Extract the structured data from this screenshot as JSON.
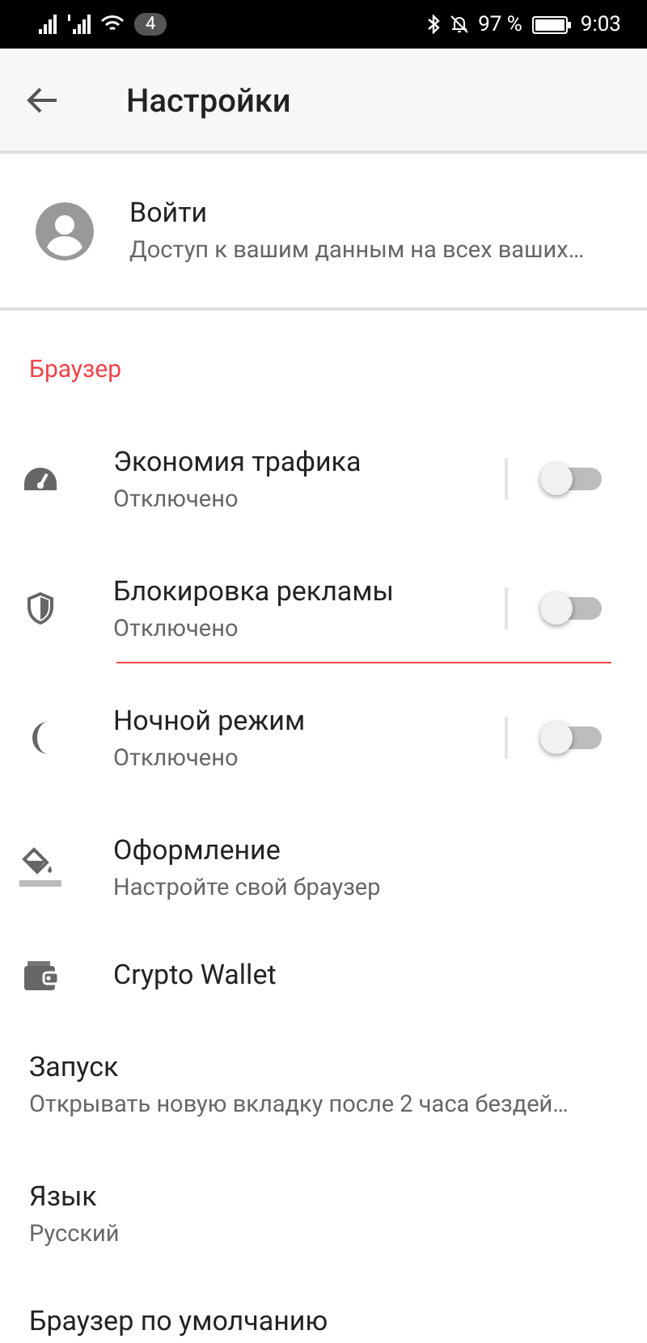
{
  "status_bar": {
    "notification_count": "4",
    "battery": "97 %",
    "time": "9:03"
  },
  "app_bar": {
    "title": "Настройки"
  },
  "account": {
    "title": "Войти",
    "subtitle": "Доступ к вашим данным на всех ваших…"
  },
  "section": {
    "title": "Браузер"
  },
  "items": [
    {
      "kind": "toggle",
      "title": "Экономия трафика",
      "subtitle": "Отключено",
      "on": false,
      "focused": false
    },
    {
      "kind": "toggle",
      "title": "Блокировка рекламы",
      "subtitle": "Отключено",
      "on": false,
      "focused": true
    },
    {
      "kind": "toggle",
      "title": "Ночной режим",
      "subtitle": "Отключено",
      "on": false,
      "focused": false
    },
    {
      "kind": "link",
      "title": "Оформление",
      "subtitle": "Настройте свой браузер"
    },
    {
      "kind": "link",
      "title": "Crypto Wallet"
    },
    {
      "kind": "plain",
      "title": "Запуск",
      "subtitle": "Открывать новую вкладку после 2 часа бездей…"
    },
    {
      "kind": "plain",
      "title": "Язык",
      "subtitle": "Русский"
    },
    {
      "kind": "plain",
      "title": "Браузер по умолчанию"
    }
  ]
}
